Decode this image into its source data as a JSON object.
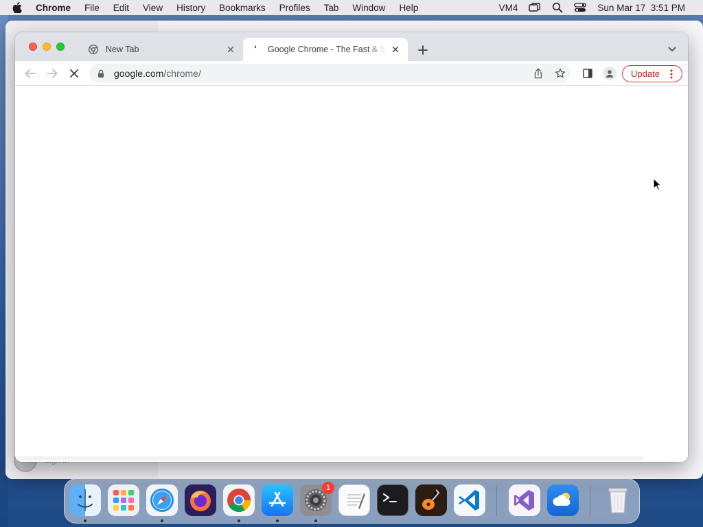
{
  "menubar": {
    "app_name": "Chrome",
    "items": [
      "File",
      "Edit",
      "View",
      "History",
      "Bookmarks",
      "Profiles",
      "Tab",
      "Window",
      "Help"
    ],
    "status": {
      "vm_label": "VM4",
      "datetime": "Sun Mar 17  3:51 PM"
    },
    "icons": [
      "apple-icon",
      "screen-mirroring-icon",
      "spotlight-search-icon",
      "control-center-icon"
    ]
  },
  "browser": {
    "tabs": [
      {
        "title": "New Tab",
        "favicon": "chrome-icon",
        "active": false
      },
      {
        "title": "Google Chrome - The Fast & Secure",
        "favicon": "loading-spinner-icon",
        "active": true
      }
    ],
    "omnibox": {
      "host": "google.com",
      "path": "/chrome/"
    },
    "update_label": "Update"
  },
  "background_window": {
    "sign_in_label": "Sign in"
  },
  "dock": {
    "apps": [
      {
        "name": "Finder",
        "running": true
      },
      {
        "name": "Launchpad",
        "running": false
      },
      {
        "name": "Safari",
        "running": true
      },
      {
        "name": "Firefox",
        "running": false
      },
      {
        "name": "Google Chrome",
        "running": true
      },
      {
        "name": "App Store",
        "running": true
      },
      {
        "name": "System Preferences",
        "running": true,
        "badge": "1"
      },
      {
        "name": "TextEdit",
        "running": false
      },
      {
        "name": "Terminal",
        "running": false
      },
      {
        "name": "GarageBand",
        "running": false
      },
      {
        "name": "Visual Studio Code",
        "running": false
      },
      {
        "name": "Visual Studio",
        "running": false
      },
      {
        "name": "Weather",
        "running": false
      },
      {
        "name": "Trash",
        "running": false
      }
    ]
  },
  "colors": {
    "update_red": "#d93025",
    "tabstrip_bg": "#dee1e6",
    "omnibox_bg": "#f1f3f4"
  }
}
